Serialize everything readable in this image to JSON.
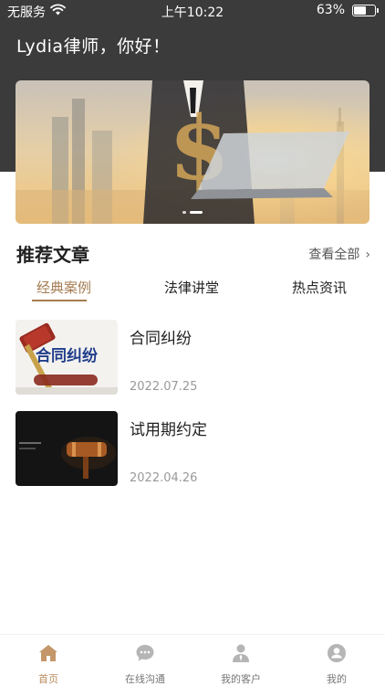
{
  "status_bar": {
    "carrier": "无服务",
    "time": "上午10:22",
    "battery": "63%",
    "battery_level": 0.63
  },
  "header": {
    "greeting": "Lydia律师，你好！"
  },
  "banner": {
    "slide_count": 2,
    "active_index": 1
  },
  "articles_section": {
    "title": "推荐文章",
    "view_all": "查看全部",
    "tabs": [
      {
        "label": "经典案例",
        "active": true
      },
      {
        "label": "法律讲堂",
        "active": false
      },
      {
        "label": "热点资讯",
        "active": false
      }
    ],
    "items": [
      {
        "title": "合同纠纷",
        "date": "2022.07.25",
        "thumb_text": "合同纠纷"
      },
      {
        "title": "试用期约定",
        "date": "2022.04.26"
      }
    ]
  },
  "tab_bar": {
    "items": [
      {
        "label": "首页",
        "icon": "home-icon",
        "active": true
      },
      {
        "label": "在线沟通",
        "icon": "chat-icon",
        "active": false
      },
      {
        "label": "我的客户",
        "icon": "clients-icon",
        "active": false
      },
      {
        "label": "我的",
        "icon": "profile-icon",
        "active": false
      }
    ]
  },
  "colors": {
    "header_bg": "#3b3b3b",
    "accent": "#a57c52",
    "tab_active": "#b88a5c",
    "tab_inactive": "#b5b5b5"
  }
}
